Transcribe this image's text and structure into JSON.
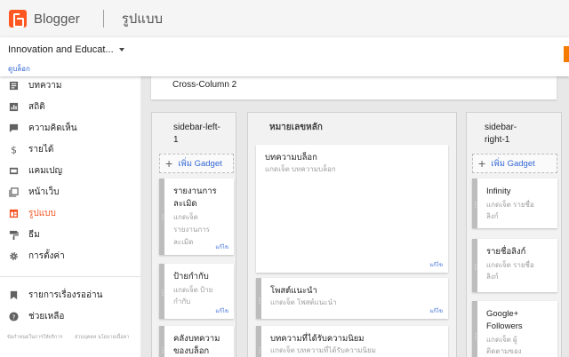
{
  "topbar": {
    "brand": "Blogger",
    "page_title": "รูปแบบ"
  },
  "blog": {
    "name": "Innovation and Educat...",
    "view_blog": "ดูบล็อก"
  },
  "sidebar": {
    "items": [
      {
        "label": "บทความ",
        "icon": "posts-icon"
      },
      {
        "label": "สถิติ",
        "icon": "stats-icon"
      },
      {
        "label": "ความคิดเห็น",
        "icon": "comments-icon"
      },
      {
        "label": "รายได้",
        "icon": "dollar-icon"
      },
      {
        "label": "แคมเปญ",
        "icon": "campaigns-icon"
      },
      {
        "label": "หน้าเว็บ",
        "icon": "pages-icon"
      },
      {
        "label": "รูปแบบ",
        "icon": "layout-icon",
        "active": true
      },
      {
        "label": "ธีม",
        "icon": "paint-roller-icon"
      },
      {
        "label": "การตั้งค่า",
        "icon": "gear-icon"
      },
      {
        "label": "รายการเรื่องรออ่าน",
        "icon": "bookmark-icon"
      },
      {
        "label": "ช่วยเหลือ",
        "icon": "help-icon"
      }
    ],
    "footer": [
      "ข้อกำหนดในการให้บริการ",
      "ส่วนบุคคล นโยบายเนื้อหา"
    ]
  },
  "main": {
    "cross_column": "Cross-Column 2",
    "add_gadget": "เพิ่ม Gadget",
    "edit": "แก้ไข",
    "left": {
      "title_1": "sidebar-left-",
      "title_2": "1",
      "gadgets": [
        {
          "t1": "รายงานการ",
          "t2": "ละเมิด",
          "s1": "แกดเจ็ต",
          "s2": "รายงานการ",
          "s3": "ละเมิด"
        },
        {
          "t1": "ป้ายกำกับ",
          "s1": "แกดเจ็ต ป้าย",
          "s2": "กำกับ"
        },
        {
          "t1": "คลังบทความ",
          "t2": "ของบล็อก"
        }
      ]
    },
    "center": {
      "title": "หมายเลขหลัก",
      "gadgets": [
        {
          "t1": "บทความบล็อก",
          "s1": "แกดเจ็ต บทความบล็อก"
        },
        {
          "t1": "โพสต์แนะนำ",
          "s1": "แกดเจ็ต โพสต์แนะนำ"
        },
        {
          "t1": "บทความที่ได้รับความนิยม",
          "s1": "แกดเจ็ต บทความที่ได้รับความนิยม"
        }
      ]
    },
    "right": {
      "title_1": "sidebar-",
      "title_2": "right-1",
      "gadgets": [
        {
          "t1": "Infinity",
          "s1": "แกดเจ็ต รายชื่อ",
          "s2": "ลิงก์"
        },
        {
          "t1": "รายชื่อลิงก์",
          "s1": "แกดเจ็ต รายชื่อ",
          "s2": "ลิงก์"
        },
        {
          "t1": "Google+",
          "t2": "Followers",
          "s1": "แกดเจ็ต ผู้",
          "s2": "ติดตามของ"
        }
      ]
    }
  },
  "colors": {
    "accent": "#ff5722",
    "link": "#3367d6",
    "active": "#f4511e"
  }
}
